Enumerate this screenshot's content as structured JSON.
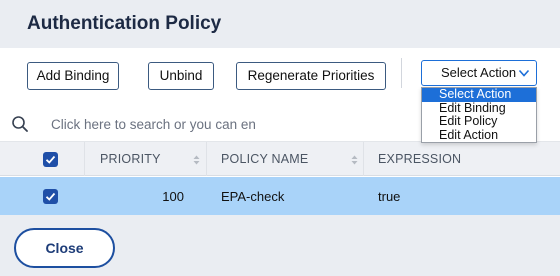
{
  "header": {
    "title": "Authentication Policy"
  },
  "toolbar": {
    "add_binding": "Add Binding",
    "unbind": "Unbind",
    "regenerate": "Regenerate Priorities",
    "select_action": "Select Action"
  },
  "dropdown": {
    "options": [
      "Select Action",
      "Edit Binding",
      "Edit Policy",
      "Edit Action"
    ],
    "selected": "Select Action"
  },
  "search": {
    "placeholder": "Click here to search or you can en"
  },
  "table": {
    "header_checked": true,
    "columns": [
      "PRIORITY",
      "POLICY NAME",
      "EXPRESSION"
    ],
    "rows": [
      {
        "checked": true,
        "priority": "100",
        "policy_name": "EPA-check",
        "expression": "true"
      }
    ]
  },
  "footer": {
    "close": "Close"
  },
  "colors": {
    "accent": "#1d6fd8",
    "selected_row": "#a9d3f9",
    "checkbox": "#1f4fa8",
    "header_bg": "#eaedf2"
  },
  "icons": [
    "search-icon",
    "chevron-down-icon",
    "checkmark-icon",
    "sort-icon"
  ]
}
